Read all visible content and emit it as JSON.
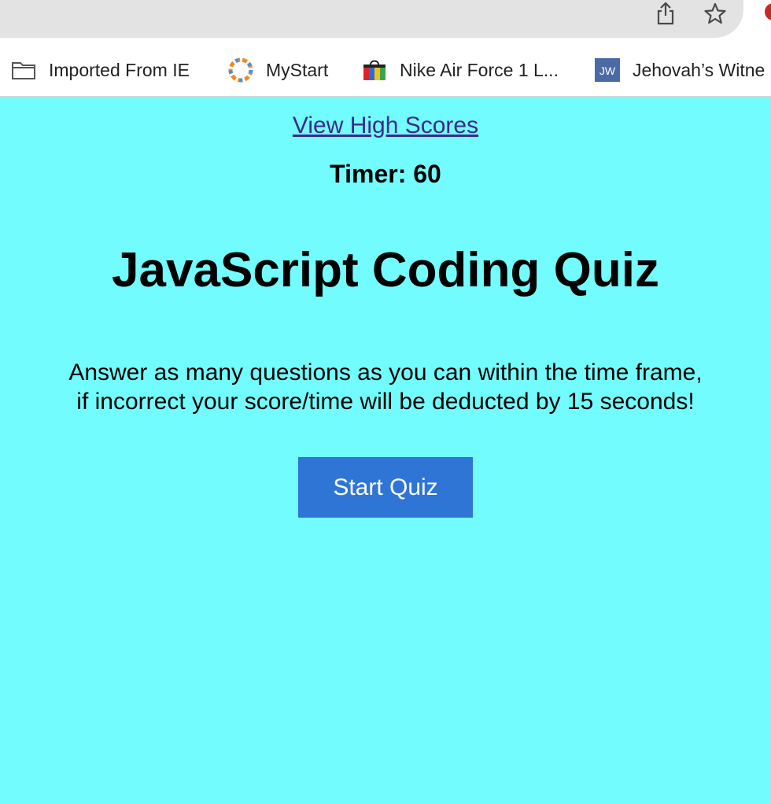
{
  "browser": {
    "toolbar_icons": [
      "share-icon",
      "star-icon"
    ],
    "bookmarks": [
      {
        "label": "Imported From IE",
        "icon": "folder-icon"
      },
      {
        "label": "MyStart",
        "icon": "mystart-icon"
      },
      {
        "label": "Nike Air Force 1 L...",
        "icon": "shopping-bag-icon"
      },
      {
        "label": "Jehovah’s Witne",
        "icon": "jw-icon"
      }
    ]
  },
  "quiz": {
    "high_scores_link": "View High Scores",
    "timer_label": "Timer: 60",
    "title": "JavaScript Coding Quiz",
    "instructions_line1": "Answer as many questions as you can within the time frame,",
    "instructions_line2": "if incorrect your score/time will be deducted by 15 seconds!",
    "start_button": "Start Quiz"
  },
  "colors": {
    "page_background": "#73fcfd",
    "button_background": "#2f75d6",
    "link_color": "#3b2a8e"
  }
}
